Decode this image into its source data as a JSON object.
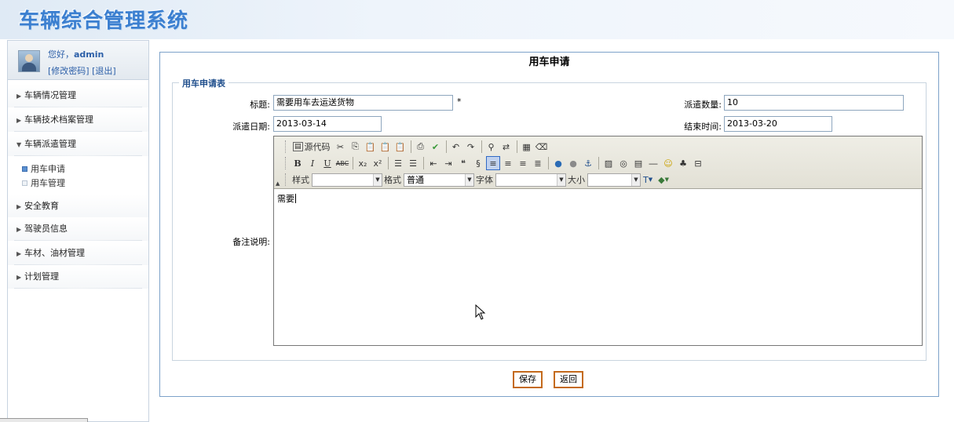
{
  "header": {
    "title": "车辆综合管理系统"
  },
  "user": {
    "greeting_prefix": "您好，",
    "name": "admin",
    "change_password": "[修改密码]",
    "logout": "[退出]"
  },
  "sidebar": {
    "items": [
      {
        "label": "车辆情况管理",
        "arrow": "▶"
      },
      {
        "label": "车辆技术档案管理",
        "arrow": "▶"
      },
      {
        "label": "车辆派遣管理",
        "arrow": "▼"
      },
      {
        "label": "安全教育",
        "arrow": "▶"
      },
      {
        "label": "驾驶员信息",
        "arrow": "▶"
      },
      {
        "label": "车材、油材管理",
        "arrow": "▶"
      },
      {
        "label": "计划管理",
        "arrow": "▶"
      }
    ],
    "sub_items": [
      {
        "label": "用车申请"
      },
      {
        "label": "用车管理"
      }
    ]
  },
  "form": {
    "page_title": "用车申请",
    "legend": "用车申请表",
    "title_label": "标题:",
    "title_value": "需要用车去运送货物",
    "required_mark": "*",
    "count_label": "派遣数量:",
    "count_value": "10",
    "date_label": "派遣日期:",
    "date_value": "2013-03-14",
    "end_label": "结束时间:",
    "end_value": "2013-03-20",
    "remark_label": "备注说明:"
  },
  "editor": {
    "source_label": "源代码",
    "style_label": "样式",
    "style_value": "",
    "format_label": "格式",
    "format_value": "普通",
    "font_label": "字体",
    "font_value": "",
    "size_label": "大小",
    "size_value": "",
    "content": "需要"
  },
  "buttons": {
    "save": "保存",
    "back": "返回"
  }
}
